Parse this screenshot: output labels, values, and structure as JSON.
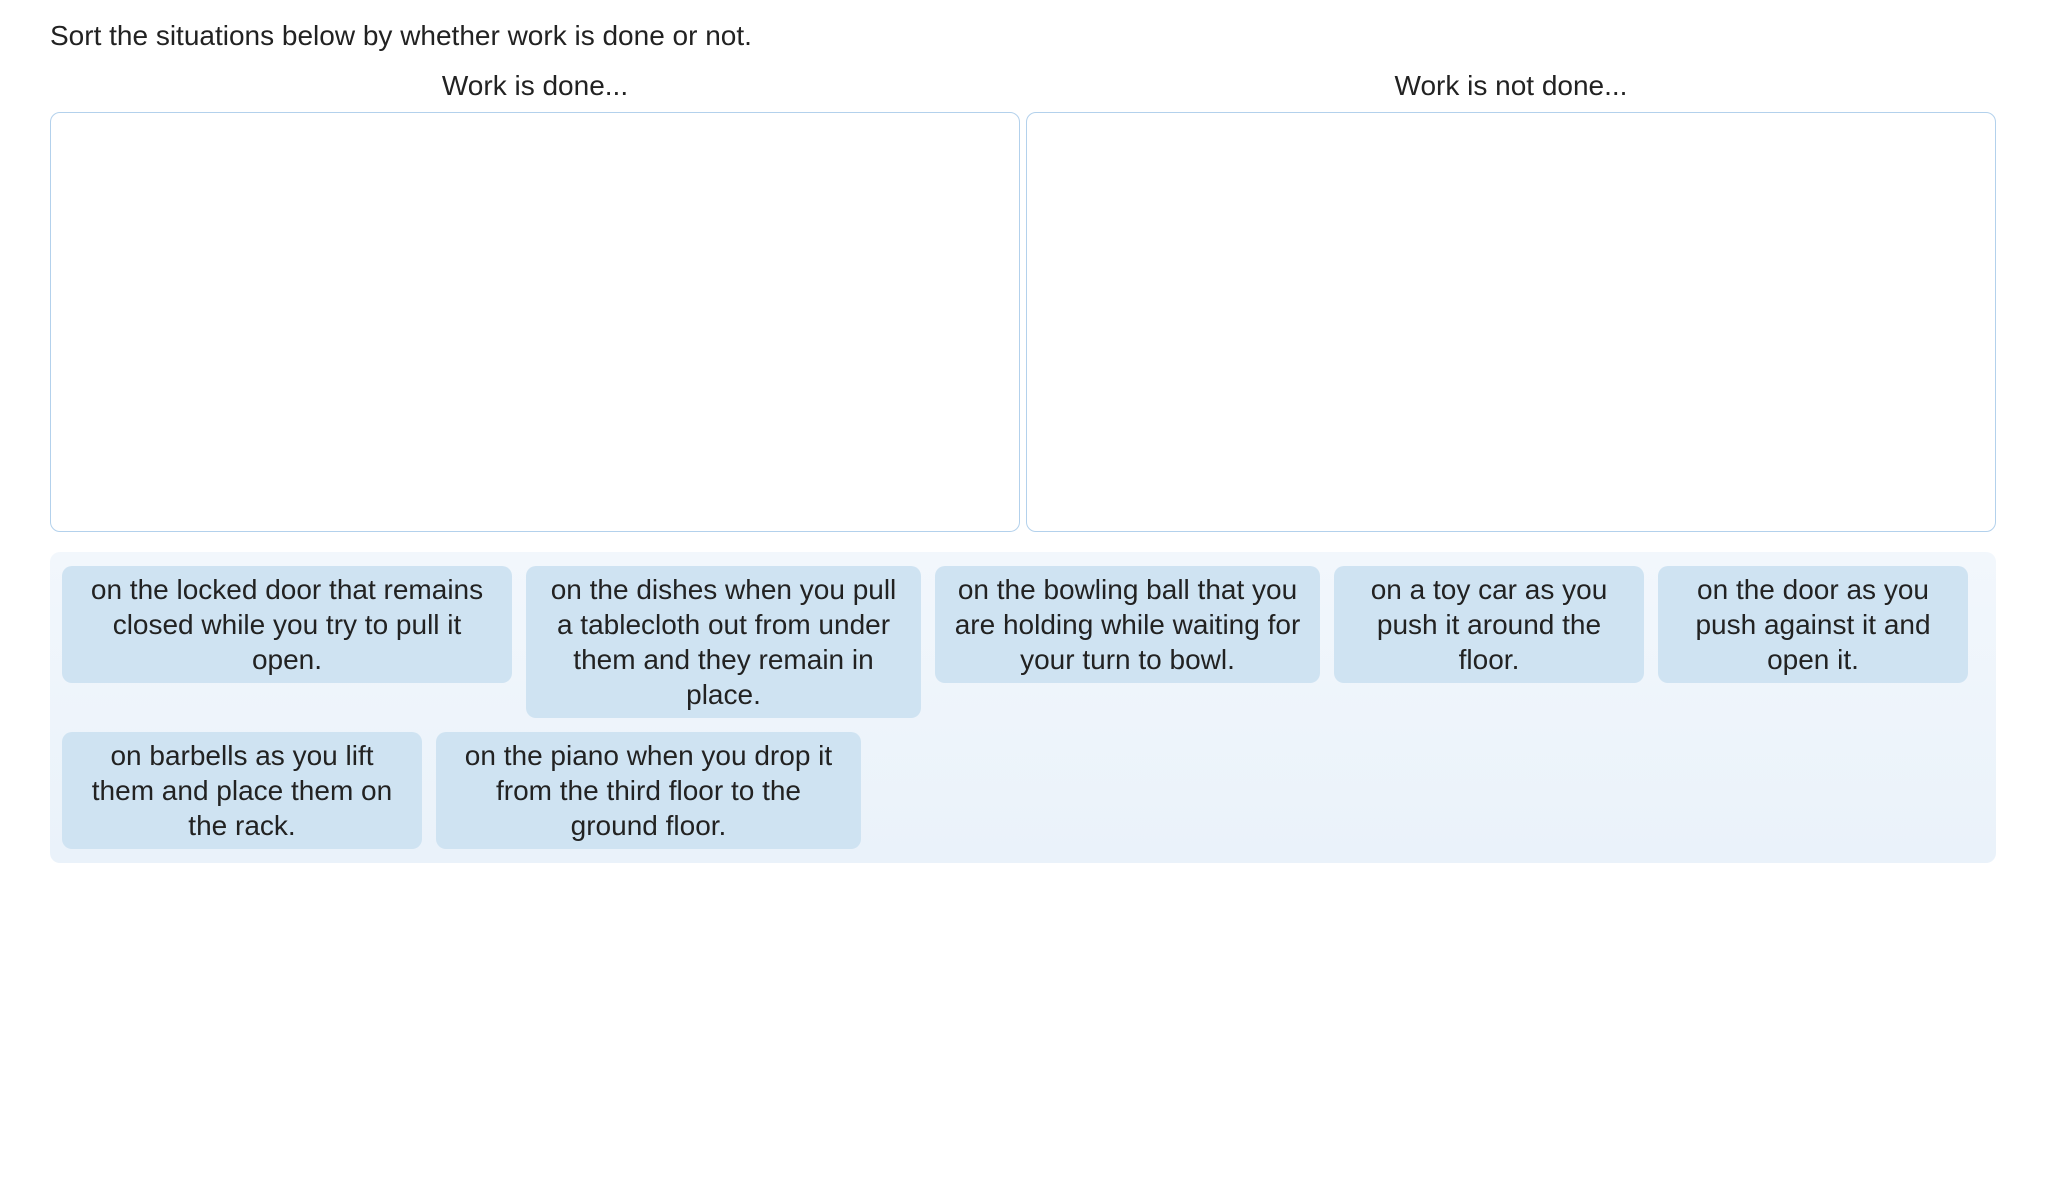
{
  "instruction": "Sort the situations below by whether work is done or not.",
  "columns": {
    "left_header": "Work is done...",
    "right_header": "Work is not done..."
  },
  "items": [
    "on the locked door that remains closed while you try to pull it open.",
    "on the dishes when you pull a tablecloth out from under them and they remain in place.",
    "on the bowling ball that you are holding while waiting for your turn to bowl.",
    "on a toy car as you push it around the floor.",
    "on the door as you push against it and open it.",
    "on barbells as you lift them and place them on the rack.",
    "on the piano when you drop it from the third floor to the ground floor."
  ]
}
